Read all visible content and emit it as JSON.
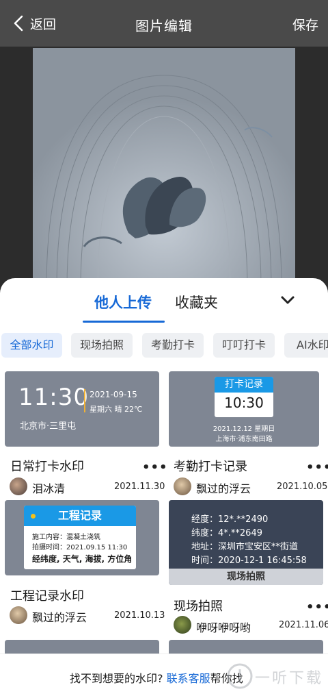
{
  "header": {
    "back_label": "返回",
    "title": "图片编辑",
    "save_label": "保存"
  },
  "sheet": {
    "tabs": [
      {
        "label": "他人上传"
      },
      {
        "label": "收藏夹"
      }
    ],
    "chips": [
      {
        "label": "全部水印"
      },
      {
        "label": "现场拍照"
      },
      {
        "label": "考勤打卡"
      },
      {
        "label": "叮叮打卡"
      },
      {
        "label": "AI水印"
      }
    ]
  },
  "cards": [
    {
      "title": "日常打卡水印",
      "user": "泪冰清",
      "date": "2021.11.30",
      "preview": {
        "time": "11:30",
        "date": "2021-09-15",
        "weather": "星期六 晴 22℃",
        "location": "北京市·三里屯"
      }
    },
    {
      "title": "考勤打卡记录",
      "user": "飘过的浮云",
      "date": "2021.10.05",
      "preview": {
        "header": "打卡记录",
        "time": "10:30",
        "line1": "2021.12.12 星期日",
        "line2": "上海市·浦东南田路"
      }
    },
    {
      "title": "工程记录水印",
      "user": "飘过的浮云",
      "date": "2021.10.13",
      "preview": {
        "header": "工程记录",
        "row1": "施工内容：混凝土浇筑",
        "row2": "拍摄时间：2021.09.15 11:30",
        "row3": "经纬度, 天气, 海拔, 方位角"
      }
    },
    {
      "title": "现场拍照",
      "user": "咿呀咿呀哟",
      "date": "2021.11.06",
      "preview": {
        "row1": "经度：12*.**2490",
        "row2": "纬度：4*.**2649",
        "row3": "地址：深圳市宝安区**街道",
        "row4": "时间：2020-12-1  16:45:58",
        "footer": "现场拍照"
      }
    }
  ],
  "more_label": "•••",
  "footer": {
    "text": "找不到想要的水印? ",
    "link": "联系客服",
    "suffix": "帮你找"
  },
  "watermark": {
    "text": "一听下载"
  },
  "colors": {
    "accent": "#1769d6",
    "chip_bg": "#eef0f3",
    "preview_bg": "#7f8693",
    "header_bg": "#4a4a4a"
  }
}
